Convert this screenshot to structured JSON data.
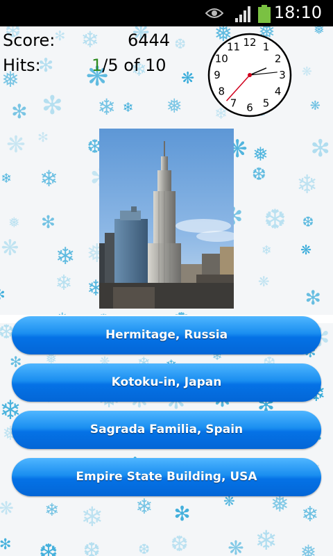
{
  "status_bar": {
    "time": "18:10",
    "icons": [
      "eye-icon",
      "signal-icon",
      "battery-icon"
    ]
  },
  "score": {
    "label": "Score:",
    "value": "6444"
  },
  "hits": {
    "label": "Hits:",
    "current": "1",
    "rest": "/5 of 10"
  },
  "clock": {
    "numerals": [
      "12",
      "1",
      "2",
      "3",
      "4",
      "5",
      "6",
      "7",
      "8",
      "9",
      "10",
      "11"
    ],
    "hour": 2,
    "minute": 14,
    "second": 37
  },
  "photo": {
    "subject": "empire-state-building-photo"
  },
  "answers": [
    {
      "label": "Hermitage, Russia"
    },
    {
      "label": "Kotoku-in, Japan"
    },
    {
      "label": "Sagrada Familia, Spain"
    },
    {
      "label": "Empire State Building, USA"
    }
  ],
  "colors": {
    "button": "#0a7ce8",
    "hits_current": "#2e8b1f",
    "flake": "#2aa6d8",
    "flake_pale": "#a9dbef"
  }
}
